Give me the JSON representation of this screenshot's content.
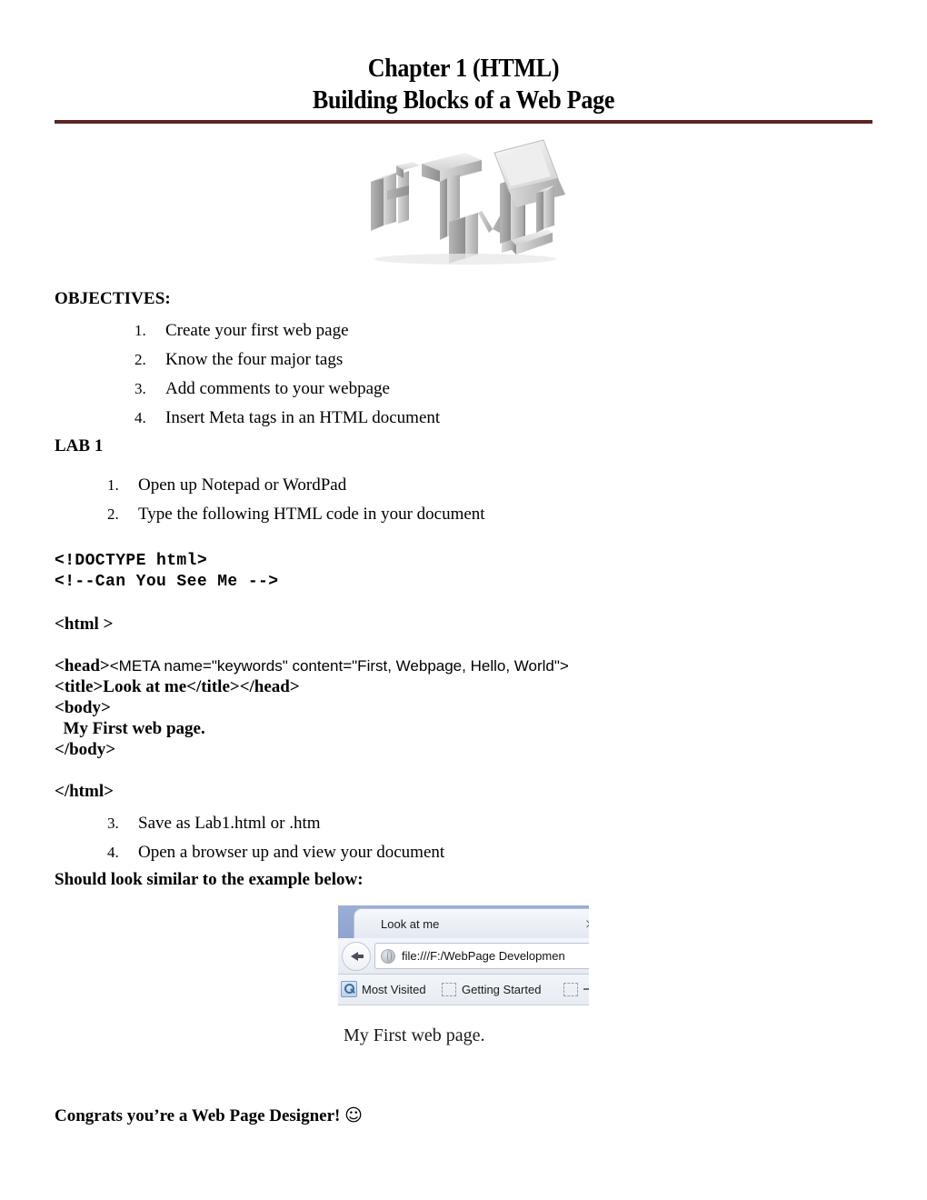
{
  "document": {
    "title_line1": "Chapter 1 (HTML)",
    "title_line2": "Building Blocks of a Web Page",
    "rule_color": "#5b2525"
  },
  "hero_image": {
    "alt": "3D grey HTML letters with laptop",
    "icon": "html-3d-letters-image"
  },
  "objectives": {
    "heading": "OBJECTIVES:",
    "items": [
      {
        "num": "1.",
        "text": "Create your first web page"
      },
      {
        "num": "2.",
        "text": "Know the four major tags"
      },
      {
        "num": "3.",
        "text": "Add comments to your webpage"
      },
      {
        "num": "4.",
        "text": "Insert Meta tags in an HTML document"
      }
    ]
  },
  "lab": {
    "heading": "LAB 1",
    "steps_before_code": [
      {
        "num": "1.",
        "text": "Open up Notepad or WordPad"
      },
      {
        "num": "2.",
        "text": "Type the following HTML code in your document"
      }
    ],
    "steps_after_code": [
      {
        "num": "3.",
        "text": "Save as Lab1.html or .htm"
      },
      {
        "num": "4.",
        "text": "Open a browser up and view your document"
      }
    ]
  },
  "code": {
    "line_doctype": "<!DOCTYPE html>",
    "line_comment": "<!--Can You See Me -->",
    "line_html_open": "<html >",
    "line_head_open": "<head>",
    "line_meta": "<META name=\"keywords\" content=\"First, Webpage, Hello, World\">",
    "line_title": "<title>Look at me</title></head>",
    "line_body_open": "<body>",
    "line_body_text": "  My First web page.",
    "line_body_close": "</body>",
    "line_html_close": "</html>"
  },
  "example_caption": "Should look similar to the example below:",
  "browser": {
    "tab_label": "Look at me",
    "close_label": "×",
    "url": "file:///F:/WebPage Developmen",
    "bookmark_1": "Most Visited",
    "bookmark_2": "Getting Started",
    "page_text": "My First web page."
  },
  "footer": {
    "congrats": "Congrats you’re a Web Page Designer!",
    "smiley": "☺"
  }
}
